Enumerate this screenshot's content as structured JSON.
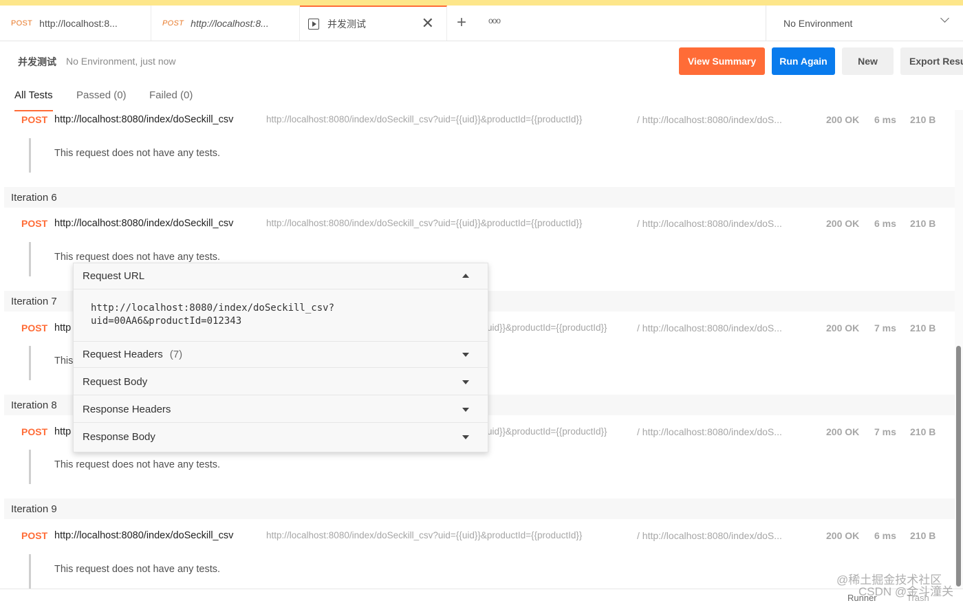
{
  "tabs": [
    {
      "method": "POST",
      "label": "http://localhost:8..."
    },
    {
      "method": "POST",
      "label": "http://localhost:8..."
    },
    {
      "label": "并发测试",
      "close": "✕"
    }
  ],
  "new_tab": "+",
  "more": "ooo",
  "environment": "No Environment",
  "run": {
    "title": "并发测试",
    "meta": "No Environment, just now"
  },
  "buttons": {
    "view_summary": "View Summary",
    "run_again": "Run Again",
    "new": "New",
    "export": "Export Results"
  },
  "filter_tabs": {
    "all": "All Tests",
    "passed": "Passed (0)",
    "failed": "Failed (0)"
  },
  "requests": [
    {
      "method": "POST",
      "name": "http://localhost:8080/index/doSeckill_csv",
      "url": "http://localhost:8080/index/doSeckill_csv?uid={{uid}}&productId={{productId}}",
      "resolved": "/ http://localhost:8080/index/doS...",
      "status": "200 OK",
      "time": "6 ms",
      "size": "210 B",
      "tests": "This request does not have any tests."
    },
    {
      "method": "POST",
      "name": "http://localhost:8080/index/doSeckill_csv",
      "url": "http://localhost:8080/index/doSeckill_csv?uid={{uid}}&productId={{productId}}",
      "resolved": "/ http://localhost:8080/index/doS...",
      "status": "200 OK",
      "time": "6 ms",
      "size": "210 B",
      "tests": "This request does not have any tests."
    },
    {
      "method": "POST",
      "name": "http",
      "url": "uid}}&productId={{productId}}",
      "resolved": "/ http://localhost:8080/index/doS...",
      "status": "200 OK",
      "time": "7 ms",
      "size": "210 B",
      "tests": "This"
    },
    {
      "method": "POST",
      "name": "http",
      "url": "uid}}&productId={{productId}}",
      "resolved": "/ http://localhost:8080/index/doS...",
      "status": "200 OK",
      "time": "7 ms",
      "size": "210 B",
      "tests": "This request does not have any tests."
    },
    {
      "method": "POST",
      "name": "http://localhost:8080/index/doSeckill_csv",
      "url": "http://localhost:8080/index/doSeckill_csv?uid={{uid}}&productId={{productId}}",
      "resolved": "/ http://localhost:8080/index/doS...",
      "status": "200 OK",
      "time": "6 ms",
      "size": "210 B",
      "tests": "This request does not have any tests."
    }
  ],
  "iterations": [
    "Iteration 6",
    "Iteration 7",
    "Iteration 8",
    "Iteration 9"
  ],
  "popup": {
    "request_url_label": "Request URL",
    "request_url_value": "http://localhost:8080/index/doSeckill_csv?\nuid=00AA6&productId=012343",
    "request_headers_label": "Request Headers",
    "request_headers_count": "(7)",
    "request_body_label": "Request Body",
    "response_headers_label": "Response Headers",
    "response_body_label": "Response Body"
  },
  "footer": {
    "runner": "Runner",
    "trash": "Trash"
  },
  "watermark": {
    "line1": "@稀土掘金技术社区",
    "line2": "CSDN @金斗潼关"
  },
  "colors": {
    "accent": "#ff6c37",
    "primary": "#097bed",
    "top_strip": "#fde68a"
  }
}
